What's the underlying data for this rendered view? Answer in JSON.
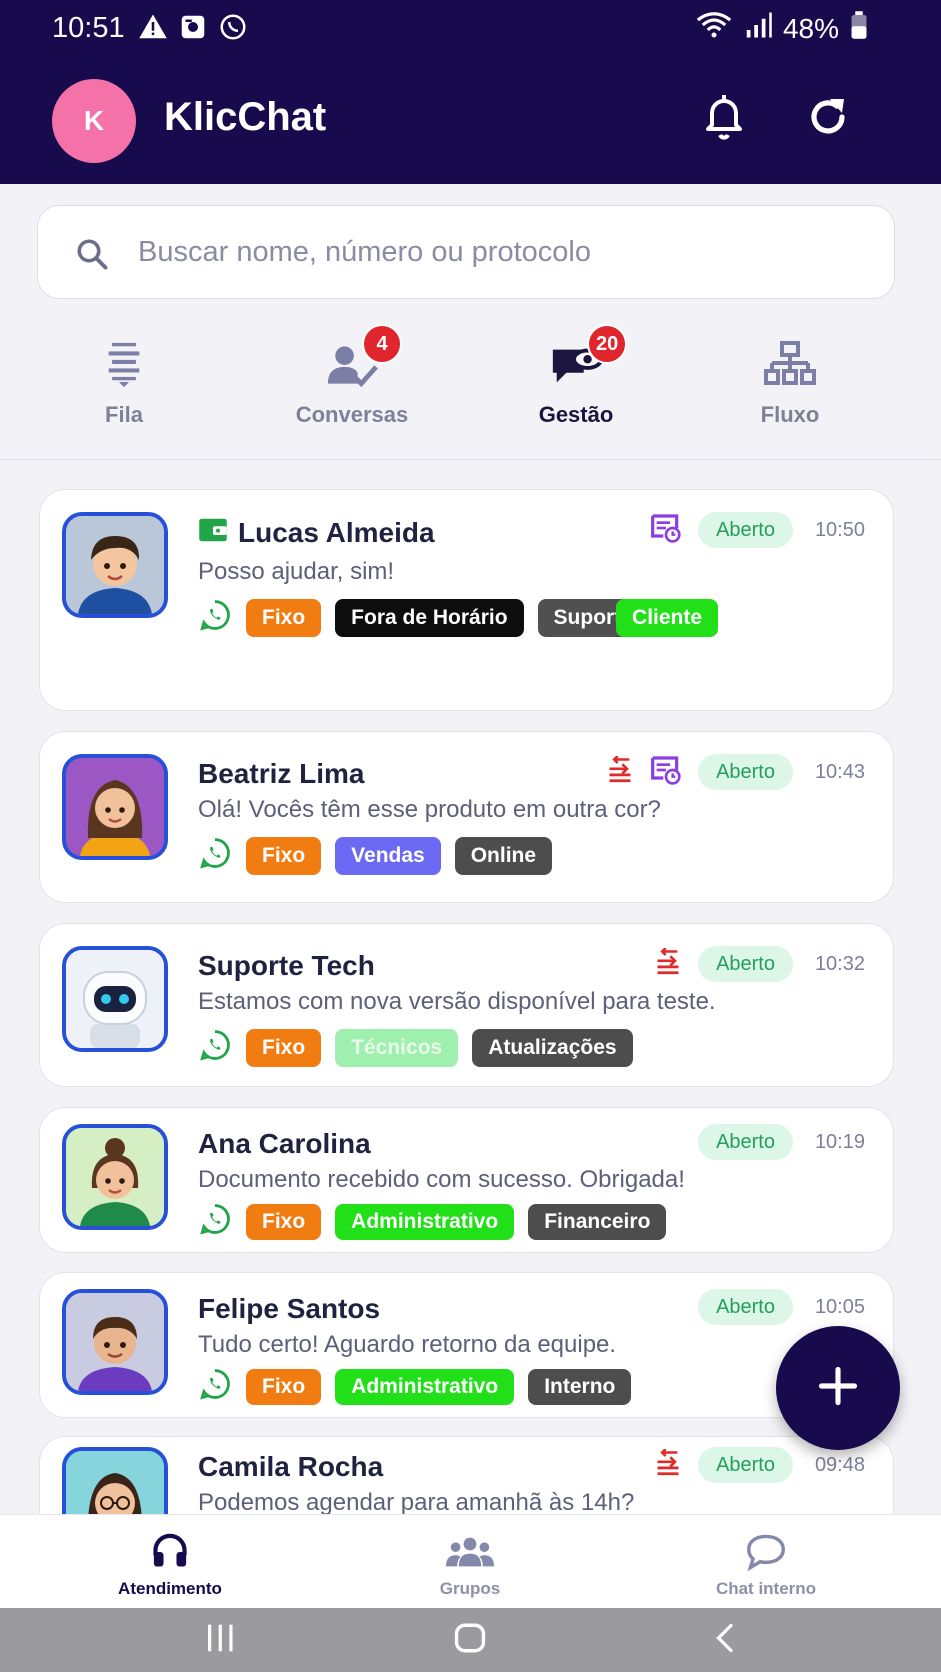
{
  "status_bar": {
    "time": "10:51",
    "battery": "48%"
  },
  "header": {
    "avatar_initial": "K",
    "title": "KlicChat"
  },
  "search": {
    "placeholder": "Buscar nome, número ou protocolo",
    "value": ""
  },
  "tabs": [
    {
      "label": "Fila",
      "badge": null,
      "active": false
    },
    {
      "label": "Conversas",
      "badge": "4",
      "active": false
    },
    {
      "label": "Gestão",
      "badge": "20",
      "active": true
    },
    {
      "label": "Fluxo",
      "badge": null,
      "active": false
    }
  ],
  "conversations": [
    {
      "name": "Lucas Almeida",
      "message": "Posso ajudar, sim!",
      "status": "Aberto",
      "time": "10:50",
      "tags": [
        {
          "label": "Fixo",
          "color": "#f07c12"
        },
        {
          "label": "Fora de Horário",
          "color": "#0d0d0d"
        },
        {
          "label": "Suporto",
          "color": "#505050"
        },
        {
          "label": "Cliente",
          "color": "#22e018"
        }
      ]
    },
    {
      "name": "Beatriz Lima",
      "message": "Olá! Vocês têm esse produto em outra cor?",
      "status": "Aberto",
      "time": "10:43",
      "tags": [
        {
          "label": "Fixo",
          "color": "#f07c12"
        },
        {
          "label": "Vendas",
          "color": "#6c6af5"
        },
        {
          "label": "Online",
          "color": "#4d4d4d"
        }
      ]
    },
    {
      "name": "Suporte Tech",
      "message": "Estamos com nova versão disponível para teste.",
      "status": "Aberto",
      "time": "10:32",
      "tags": [
        {
          "label": "Fixo",
          "color": "#f07c12"
        },
        {
          "label": "Técnicos",
          "color": "#9fefae"
        },
        {
          "label": "Atualizações",
          "color": "#4d4d4d"
        }
      ]
    },
    {
      "name": "Ana Carolina",
      "message": "Documento recebido com sucesso. Obrigada!",
      "status": "Aberto",
      "time": "10:19",
      "tags": [
        {
          "label": "Fixo",
          "color": "#f07c12"
        },
        {
          "label": "Administrativo",
          "color": "#22e018"
        },
        {
          "label": "Financeiro",
          "color": "#4d4d4d"
        }
      ]
    },
    {
      "name": "Felipe Santos",
      "message": "Tudo certo! Aguardo retorno da equipe.",
      "status": "Aberto",
      "time": "10:05",
      "tags": [
        {
          "label": "Fixo",
          "color": "#f07c12"
        },
        {
          "label": "Administrativo",
          "color": "#22e018"
        },
        {
          "label": "Interno",
          "color": "#4d4d4d"
        }
      ]
    },
    {
      "name": "Camila Rocha",
      "message": "Podemos agendar para amanhã às 14h?",
      "status": "Aberto",
      "time": "09:48",
      "tags": []
    }
  ],
  "bottom_nav": [
    {
      "label": "Atendimento",
      "icon": "headset-icon",
      "active": true
    },
    {
      "label": "Grupos",
      "icon": "group-icon",
      "active": false
    },
    {
      "label": "Chat interno",
      "icon": "chat-bubble-icon",
      "active": false
    }
  ],
  "colors": {
    "primary": "#170a4d",
    "open_status_bg": "#dcf6e7",
    "open_status_text": "#24a05c",
    "badge": "#e0262c",
    "whatsapp": "#22a548",
    "avatar_k": "#f472a8"
  }
}
